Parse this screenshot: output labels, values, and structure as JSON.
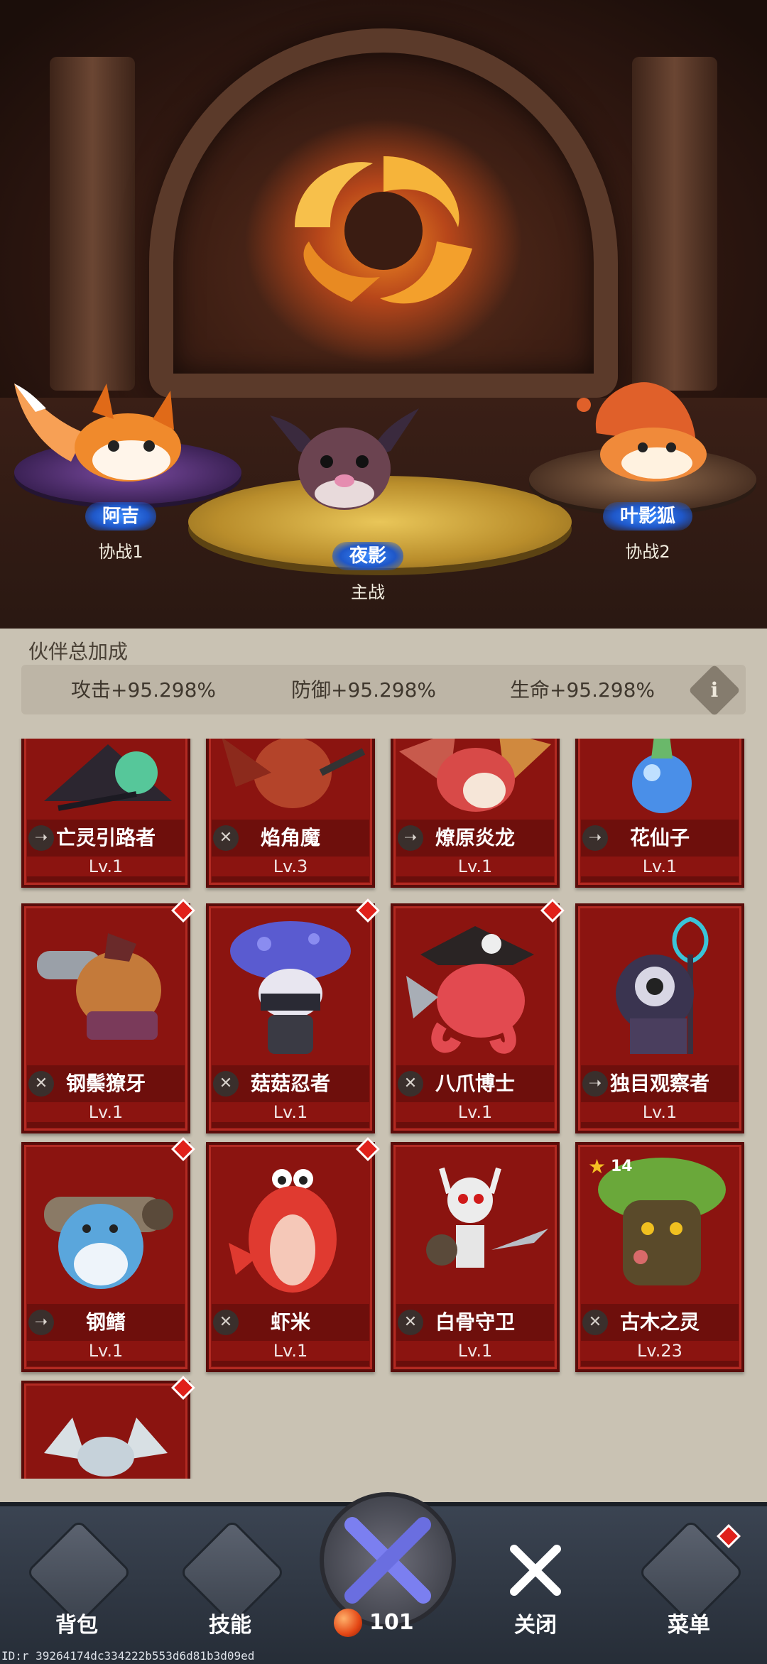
{
  "arena": {
    "slots": [
      {
        "name": "阿吉",
        "role": "协战1"
      },
      {
        "name": "夜影",
        "role": "主战"
      },
      {
        "name": "叶影狐",
        "role": "协战2"
      }
    ]
  },
  "bonus": {
    "title": "伙伴总加成",
    "attack": "攻击+95.298%",
    "defense": "防御+95.298%",
    "hp": "生命+95.298%",
    "info_icon": "i"
  },
  "partners": [
    {
      "name": "亡灵引路者",
      "level": "Lv.1",
      "tag": "ranged"
    },
    {
      "name": "焰角魔",
      "level": "Lv.3",
      "tag": "melee"
    },
    {
      "name": "燎原炎龙",
      "level": "Lv.1",
      "tag": "ranged"
    },
    {
      "name": "花仙子",
      "level": "Lv.1",
      "tag": "ranged"
    },
    {
      "name": "钢鬃獠牙",
      "level": "Lv.1",
      "tag": "melee",
      "new": true
    },
    {
      "name": "菇菇忍者",
      "level": "Lv.1",
      "tag": "melee",
      "new": true
    },
    {
      "name": "八爪博士",
      "level": "Lv.1",
      "tag": "melee",
      "new": true
    },
    {
      "name": "独目观察者",
      "level": "Lv.1",
      "tag": "ranged"
    },
    {
      "name": "钢鳍",
      "level": "Lv.1",
      "tag": "ranged",
      "new": true
    },
    {
      "name": "虾米",
      "level": "Lv.1",
      "tag": "melee",
      "new": true
    },
    {
      "name": "白骨守卫",
      "level": "Lv.1",
      "tag": "melee"
    },
    {
      "name": "古木之灵",
      "level": "Lv.23",
      "tag": "melee",
      "stars": "14"
    },
    {
      "name": "",
      "level": "",
      "tag": "",
      "new": true
    }
  ],
  "nav": {
    "bag": "背包",
    "skills": "技能",
    "energy": "101",
    "close": "关闭",
    "menu": "菜单"
  },
  "debug_id": "ID:r 39264174dc334222b553d6d81b3d09ed",
  "colors": {
    "card_red": "#8b1410",
    "name_pill_blue": "#2f6fe0",
    "badge_red": "#e0201a",
    "nav_bg": "#2f3640"
  }
}
